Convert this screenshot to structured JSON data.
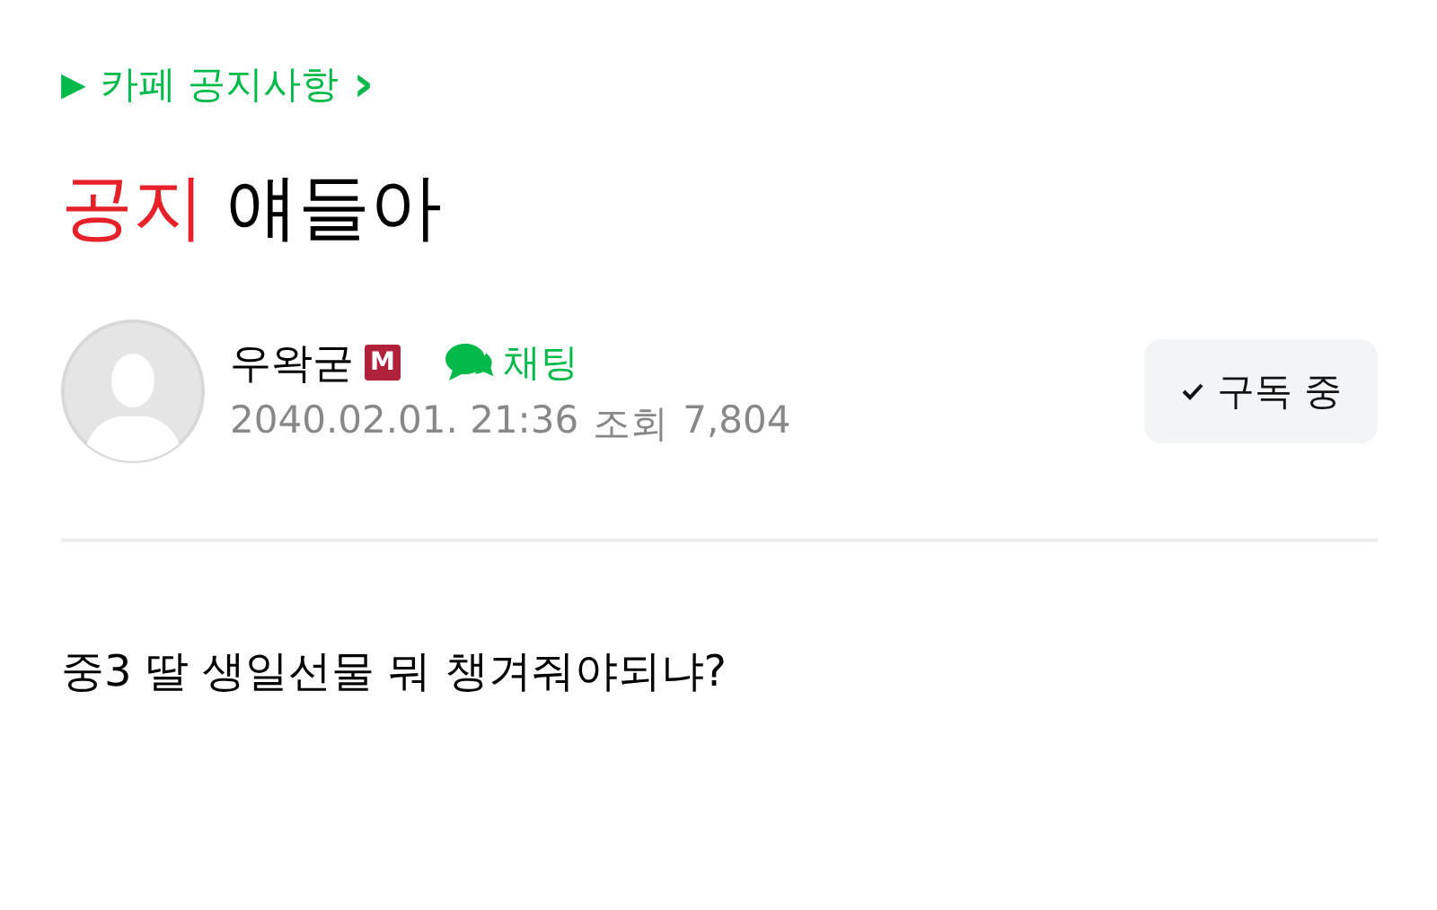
{
  "breadcrumb": {
    "arrow": "▶",
    "label": "카페 공지사항",
    "chevron": "›"
  },
  "title": {
    "tag": "공지",
    "text": "얘들아"
  },
  "author": {
    "name": "우왁굳",
    "badge": "M",
    "chat": "채팅",
    "date": "2040.02.01. 21:36",
    "views_label": "조회",
    "views": "7,804"
  },
  "subscribe": {
    "label": "구독 중",
    "subscribed": true
  },
  "body": "중3 딸 생일선물 뭐 챙겨줘야되냐?"
}
